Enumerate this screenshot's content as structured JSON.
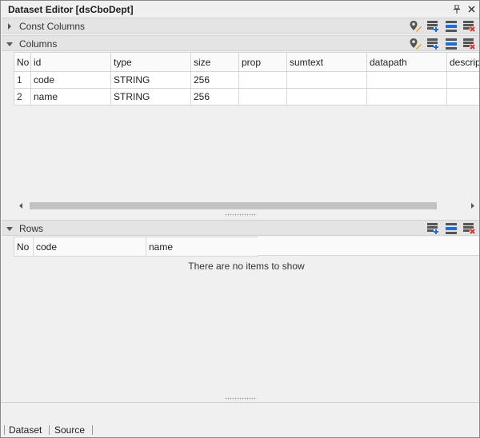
{
  "window": {
    "title": "Dataset Editor [dsCboDept]"
  },
  "const_columns": {
    "label": "Const Columns",
    "expanded": false
  },
  "columns": {
    "label": "Columns",
    "expanded": true,
    "headers": [
      "No",
      "id",
      "type",
      "size",
      "prop",
      "sumtext",
      "datapath",
      "descrip"
    ],
    "rows": [
      [
        "1",
        "code",
        "STRING",
        "256",
        "",
        "",
        "",
        ""
      ],
      [
        "2",
        "name",
        "STRING",
        "256",
        "",
        "",
        "",
        ""
      ]
    ]
  },
  "rows_section": {
    "label": "Rows",
    "expanded": true,
    "headers": [
      "No",
      "code",
      "name"
    ],
    "empty_message": "There are no items to show"
  },
  "tabs": [
    {
      "label": "Dataset",
      "active": true
    },
    {
      "label": "Source",
      "active": false
    }
  ],
  "icons": {
    "pin": "pin-icon",
    "close": "close-icon",
    "header": [
      "set-location-icon",
      "add-row-icon",
      "insert-row-icon",
      "delete-row-icon"
    ]
  },
  "colors": {
    "accent": "#1e6fd9",
    "delete": "#d9342b",
    "location": "#e8a317"
  }
}
